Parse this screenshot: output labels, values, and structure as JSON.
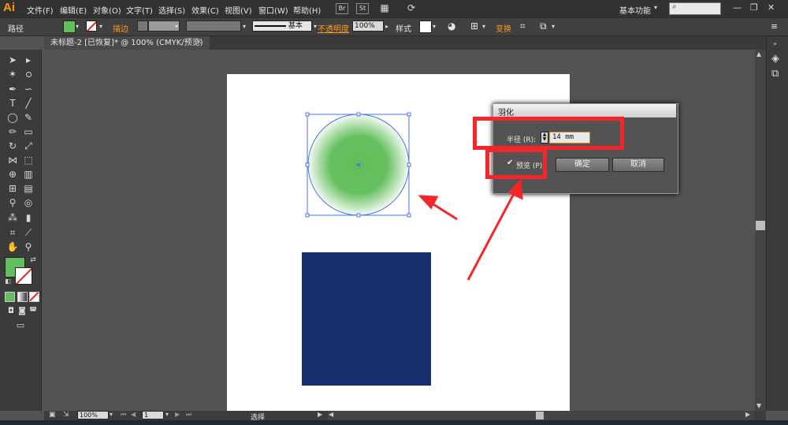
{
  "app": {
    "logo": "Ai"
  },
  "menu": [
    "文件(F)",
    "编辑(E)",
    "对象(O)",
    "文字(T)",
    "选择(S)",
    "效果(C)",
    "视图(V)",
    "窗口(W)",
    "帮助(H)"
  ],
  "menubar_icons": {
    "br": "Br",
    "st": "St"
  },
  "workspace": {
    "label": "基本功能"
  },
  "controlbar": {
    "object_label": "路径",
    "stroke_label": "描边",
    "brush_label": "基本",
    "opacity_label": "不透明度",
    "opacity_value": "100%",
    "style_label": "样式",
    "transform_label": "变换"
  },
  "document": {
    "tab_title": "未标题-2 [已恢复]* @ 100% (CMYK/预览)"
  },
  "colors": {
    "fill": "#62be5b",
    "rect": "#15306b",
    "annotation": "#f4262a",
    "accent": "#ff9a00"
  },
  "dialog": {
    "title": "羽化",
    "radius_label": "半径 (R):",
    "radius_value": "14 mm",
    "preview_label": "预览 (P)",
    "preview_checked": true,
    "ok_label": "确定",
    "cancel_label": "取消"
  },
  "status": {
    "zoom": "100%",
    "page": "1",
    "tool_text": "选择"
  }
}
